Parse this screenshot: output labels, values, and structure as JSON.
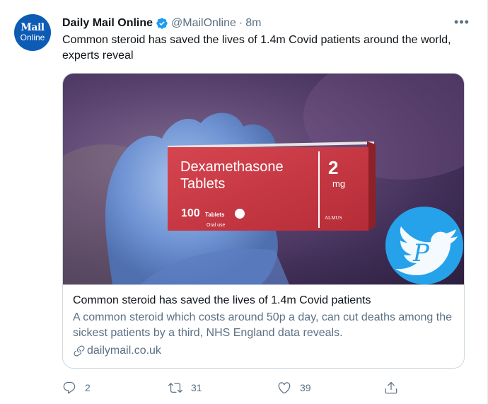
{
  "author": {
    "display_name": "Daily Mail Online",
    "handle": "@MailOnline",
    "separator": "·",
    "time": "8m",
    "avatar_line1": "Mail",
    "avatar_line2": "Online",
    "verified": true
  },
  "tweet": {
    "text": "Common steroid has saved the lives of 1.4m Covid patients around the world, experts reveal"
  },
  "card": {
    "image": {
      "box_name": "Dexamethasone",
      "box_subname": "Tablets",
      "dose_number": "2",
      "dose_unit": "mg",
      "count": "100",
      "count_label": "Tablets",
      "oral_use": "Oral use",
      "maker": "ALMUS"
    },
    "title": "Common steroid has saved the lives of 1.4m Covid patients",
    "description": "A common steroid which costs around 50p a day, can cut deaths among the sickest patients by a third, NHS England data reveals.",
    "domain": "dailymail.co.uk"
  },
  "actions": {
    "replies": "2",
    "retweets": "31",
    "likes": "39"
  },
  "colors": {
    "brand_blue": "#1d9bf0",
    "box_red": "#c8363f",
    "text_secondary": "#5b7083"
  }
}
